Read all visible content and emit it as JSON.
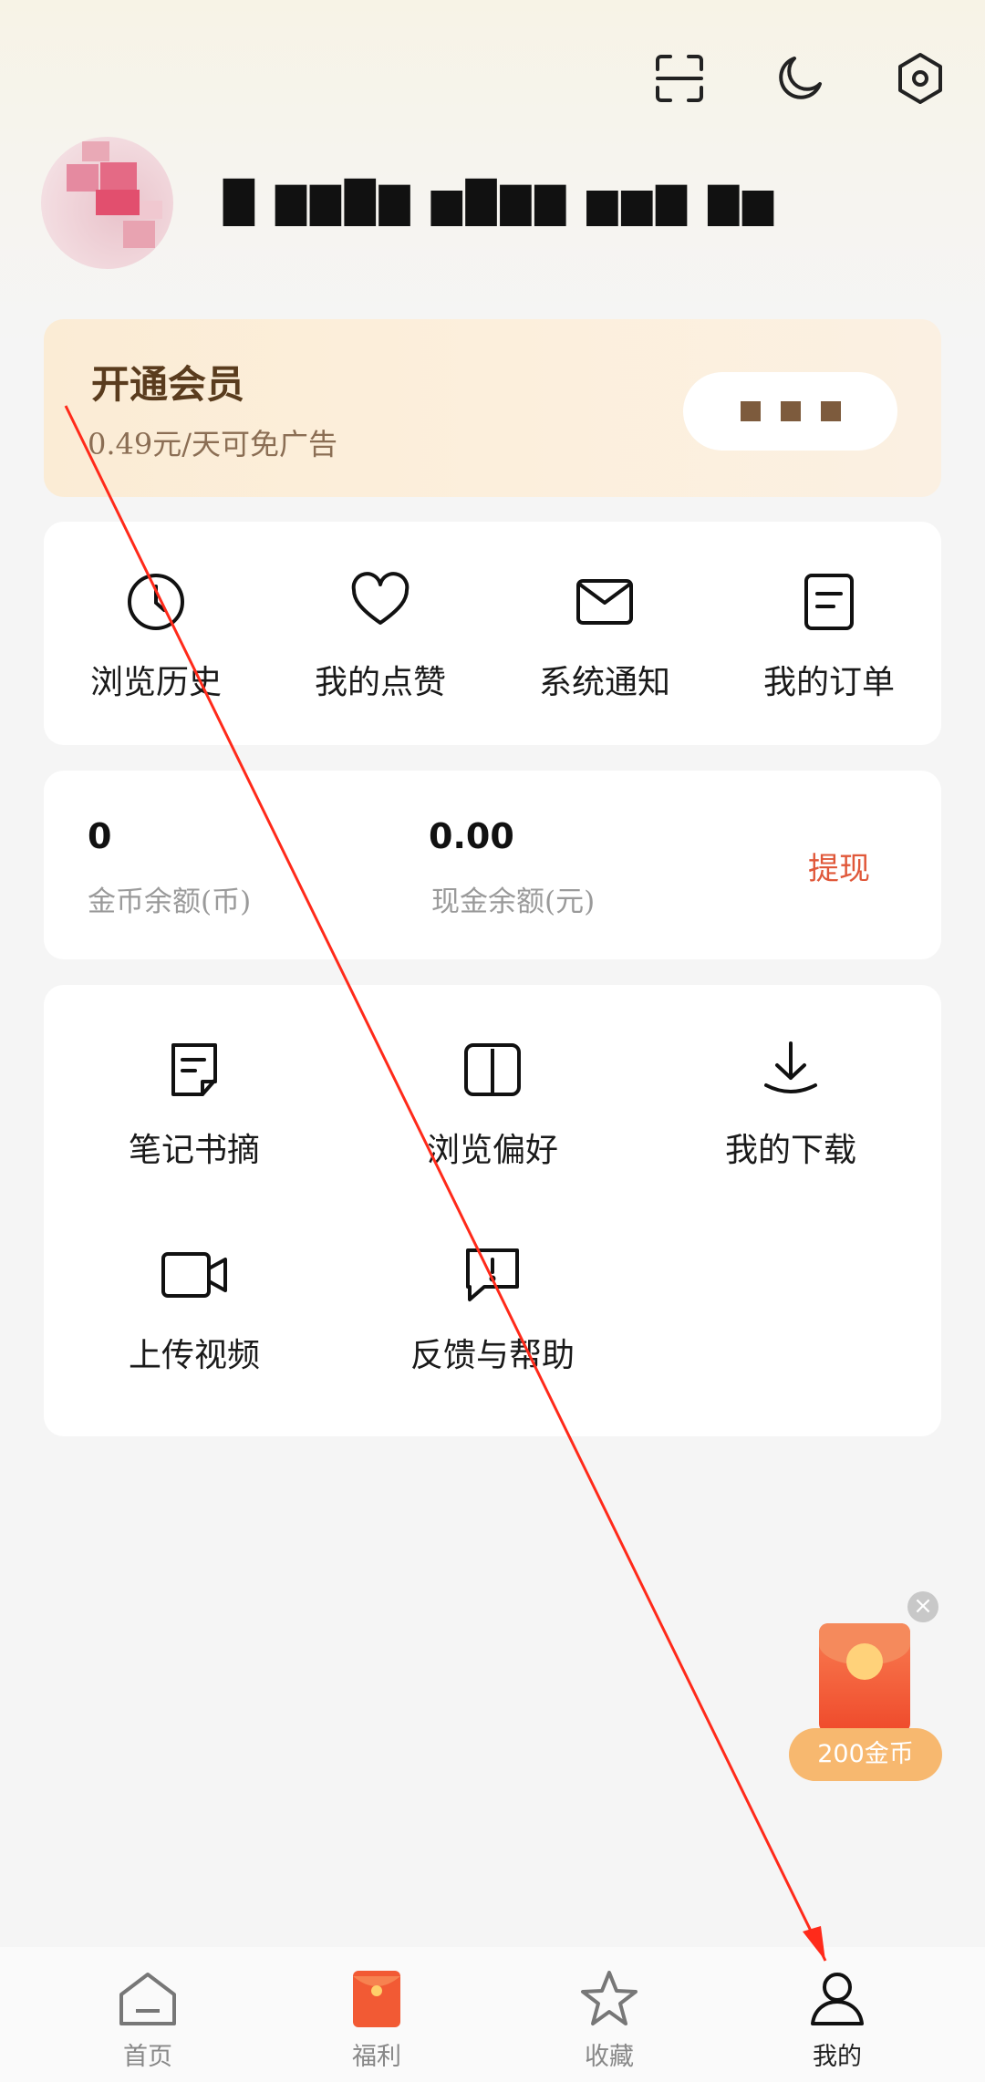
{
  "header": {
    "icons": [
      "scan-icon",
      "night-mode-icon",
      "settings-icon"
    ],
    "username": "█ ▇▇█▇ ▆█▇▇ ▆▆▇ ▇▆"
  },
  "vip": {
    "title": "开通会员",
    "subtitle": "0.49元/天可免广告"
  },
  "quick_actions": [
    {
      "label": "浏览历史",
      "icon": "clock-icon"
    },
    {
      "label": "我的点赞",
      "icon": "heart-icon"
    },
    {
      "label": "系统通知",
      "icon": "mail-icon"
    },
    {
      "label": "我的订单",
      "icon": "order-icon"
    }
  ],
  "wallet": {
    "coins_value": "0",
    "coins_label": "金币余额(币)",
    "cash_value": "0.00",
    "cash_label": "现金余额(元)",
    "withdraw_label": "提现"
  },
  "tools": [
    {
      "label": "笔记书摘",
      "icon": "note-icon"
    },
    {
      "label": "浏览偏好",
      "icon": "book-icon"
    },
    {
      "label": "我的下载",
      "icon": "download-icon"
    },
    {
      "label": "上传视频",
      "icon": "video-icon"
    },
    {
      "label": "反馈与帮助",
      "icon": "feedback-icon"
    }
  ],
  "floating": {
    "coins_label": "200金币"
  },
  "tabbar": [
    {
      "label": "首页",
      "icon": "home-icon"
    },
    {
      "label": "福利",
      "icon": "redpacket-icon"
    },
    {
      "label": "收藏",
      "icon": "star-icon"
    },
    {
      "label": "我的",
      "icon": "user-icon",
      "active": true
    }
  ],
  "colors": {
    "accent": "#e0583a",
    "vip_text": "#5a3c1e",
    "annotation_arrow": "#ff2a1a"
  }
}
